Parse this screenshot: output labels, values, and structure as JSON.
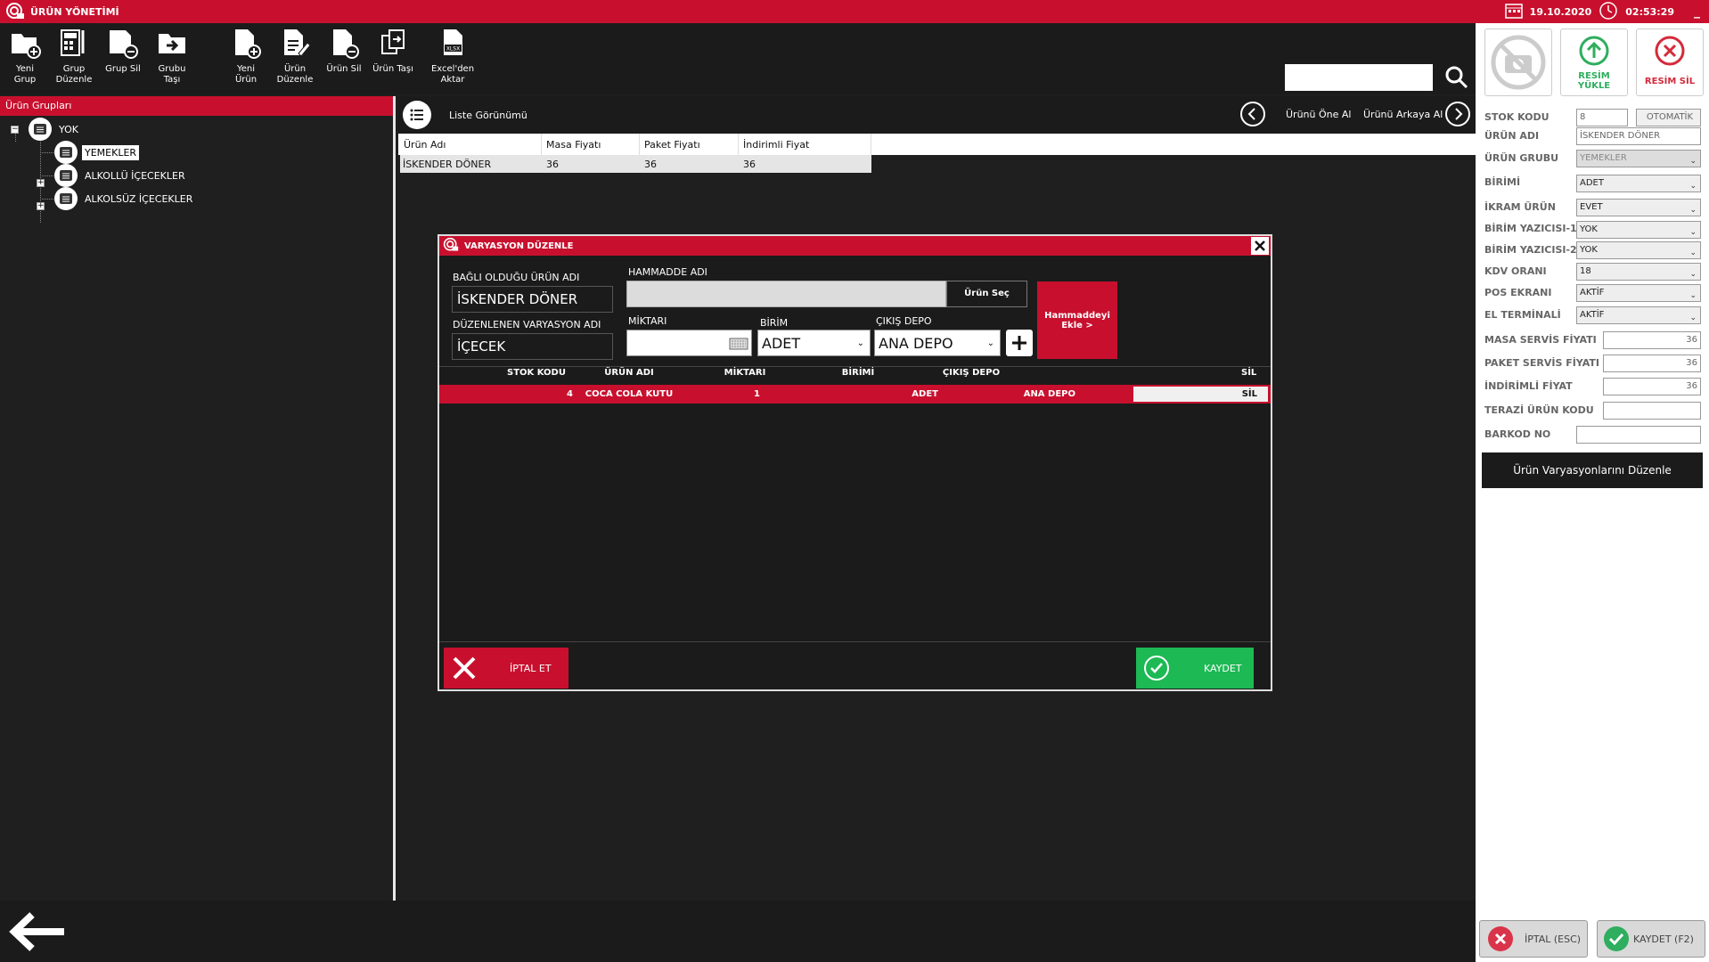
{
  "titlebar": {
    "title": "ÜRÜN YÖNETİMİ",
    "date": "19.10.2020",
    "time": "02:53:29",
    "minimize": "_"
  },
  "toolbar": {
    "new_group": "Yeni\nGrup",
    "edit_group": "Grup\nDüzenle",
    "delete_group": "Grup Sil",
    "move_group": "Grubu\nTaşı",
    "new_product": "Yeni\nÜrün",
    "edit_product": "Ürün\nDüzenle",
    "delete_product": "Ürün Sil",
    "move_product": "Ürün Taşı",
    "excel_import": "Excel'den\nAktar"
  },
  "groups": {
    "header": "Ürün Grupları",
    "items": [
      {
        "label": "YOK"
      },
      {
        "label": "YEMEKLER"
      },
      {
        "label": "ALKOLLÜ İÇECEKLER"
      },
      {
        "label": "ALKOLSÜZ İÇECEKLER"
      }
    ]
  },
  "main": {
    "view_label": "Liste Görünümü",
    "move_forward": "Ürünü Öne Al",
    "move_back": "Ürünü Arkaya Al",
    "columns": [
      "Ürün Adı",
      "Masa Fiyatı",
      "Paket Fiyatı",
      "İndirimli Fiyat"
    ],
    "rows": [
      [
        "İSKENDER DÖNER",
        "36",
        "36",
        "36"
      ]
    ]
  },
  "right": {
    "upload_image": "RESİM\nYÜKLE",
    "delete_image": "RESİM SİL",
    "stock_code_label": "STOK KODU",
    "stock_code": "8",
    "auto_button": "OTOMATİK",
    "product_name_label": "ÜRÜN ADI",
    "product_name": "İSKENDER DÖNER",
    "product_group_label": "ÜRÜN GRUBU",
    "product_group": "YEMEKLER",
    "unit_label": "BİRİMİ",
    "unit": "ADET",
    "treat_label": "İKRAM ÜRÜN",
    "treat": "EVET",
    "printer1_label": "BİRİM YAZICISI-1",
    "printer1": "YOK",
    "printer2_label": "BİRİM YAZICISI-2",
    "printer2": "YOK",
    "vat_label": "KDV ORANI",
    "vat": "18",
    "pos_label": "POS EKRANI",
    "pos": "AKTİF",
    "handheld_label": "EL TERMİNALİ",
    "handheld": "AKTİF",
    "table_price_label": "MASA SERVİS FİYATI",
    "table_price": "36",
    "package_price_label": "PAKET SERVİS FİYATI",
    "package_price": "36",
    "discount_price_label": "İNDİRİMLİ FİYAT",
    "discount_price": "36",
    "scale_code_label": "TERAZİ ÜRÜN KODU",
    "scale_code": "",
    "barcode_label": "BARKOD NO",
    "barcode": "",
    "variations_button": "Ürün Varyasyonlarını Düzenle",
    "cancel_button": "İPTAL (ESC)",
    "save_button": "KAYDET (F2)"
  },
  "dialog": {
    "title": "VARYASYON DÜZENLE",
    "parent_label": "BAĞLI OLDUĞU ÜRÜN ADI",
    "parent_value": "İSKENDER DÖNER",
    "variation_label": "DÜZENLENEN VARYASYON ADI",
    "variation_value": "İÇECEK",
    "material_label": "HAMMADDE ADI",
    "material_value": "",
    "select_product": "Ürün Seç",
    "add_material": "Hammaddeyi\nEkle  >",
    "quantity_label": "MİKTARI",
    "quantity_value": "",
    "unit_label": "BİRİM",
    "unit_value": "ADET",
    "depot_label": "ÇIKIŞ DEPO",
    "depot_value": "ANA DEPO",
    "columns": [
      "STOK KODU",
      "ÜRÜN ADI",
      "MİKTARI",
      "BİRİMİ",
      "ÇIKIŞ DEPO",
      "SİL"
    ],
    "rows": [
      {
        "stock": "4",
        "name": "COCA COLA KUTU",
        "qty": "1",
        "unit": "ADET",
        "depot": "ANA DEPO",
        "delete": "SİL"
      }
    ],
    "cancel": "İPTAL ET",
    "save": "KAYDET"
  },
  "colors": {
    "accent": "#c8102e",
    "save_green": "#1db954"
  }
}
